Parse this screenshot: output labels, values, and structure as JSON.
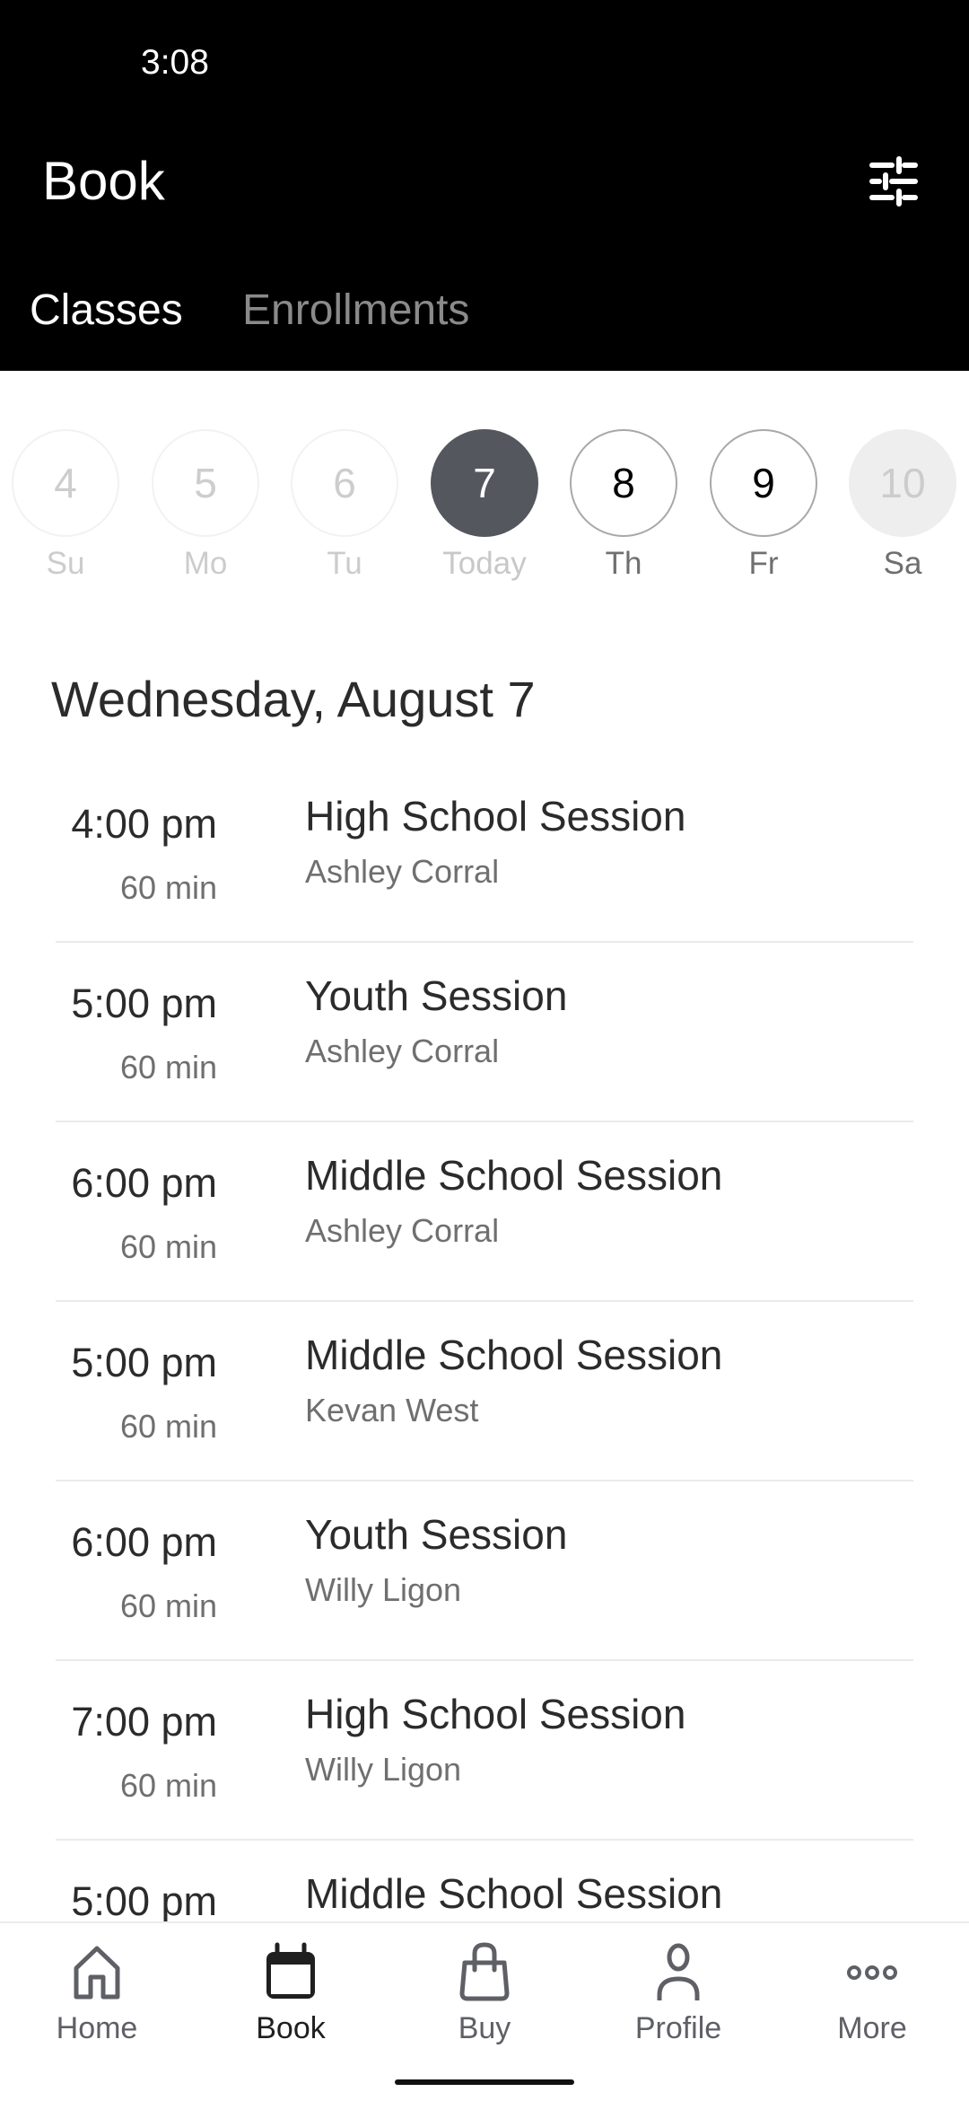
{
  "status_bar": {
    "time": "3:08"
  },
  "header": {
    "title": "Book",
    "filter_icon": "sliders-icon",
    "tabs": [
      {
        "label": "Classes",
        "active": true
      },
      {
        "label": "Enrollments",
        "active": false
      }
    ]
  },
  "date_strip": {
    "days": [
      {
        "number": "4",
        "label": "Su",
        "state": "past"
      },
      {
        "number": "5",
        "label": "Mo",
        "state": "past"
      },
      {
        "number": "6",
        "label": "Tu",
        "state": "past"
      },
      {
        "number": "7",
        "label": "Today",
        "state": "selected"
      },
      {
        "number": "8",
        "label": "Th",
        "state": "future"
      },
      {
        "number": "9",
        "label": "Fr",
        "state": "future"
      },
      {
        "number": "10",
        "label": "Sa",
        "state": "unavailable"
      }
    ]
  },
  "schedule": {
    "date_heading": "Wednesday, August 7",
    "classes": [
      {
        "time": "4:00 pm",
        "duration": "60 min",
        "name": "High School Session",
        "instructor": "Ashley Corral"
      },
      {
        "time": "5:00 pm",
        "duration": "60 min",
        "name": "Youth Session",
        "instructor": "Ashley Corral"
      },
      {
        "time": "6:00 pm",
        "duration": "60 min",
        "name": "Middle School Session",
        "instructor": "Ashley Corral"
      },
      {
        "time": "5:00 pm",
        "duration": "60 min",
        "name": "Middle School Session",
        "instructor": "Kevan West"
      },
      {
        "time": "6:00 pm",
        "duration": "60 min",
        "name": "Youth Session",
        "instructor": "Willy Ligon"
      },
      {
        "time": "7:00 pm",
        "duration": "60 min",
        "name": "High School Session",
        "instructor": "Willy Ligon"
      },
      {
        "time": "5:00 pm",
        "duration": "",
        "name": "Middle School Session",
        "instructor": ""
      }
    ]
  },
  "bottom_nav": {
    "items": [
      {
        "label": "Home",
        "icon": "home-icon",
        "active": false
      },
      {
        "label": "Book",
        "icon": "calendar-icon",
        "active": true
      },
      {
        "label": "Buy",
        "icon": "shopping-bag-icon",
        "active": false
      },
      {
        "label": "Profile",
        "icon": "person-icon",
        "active": false
      },
      {
        "label": "More",
        "icon": "more-dots-icon",
        "active": false
      }
    ]
  }
}
